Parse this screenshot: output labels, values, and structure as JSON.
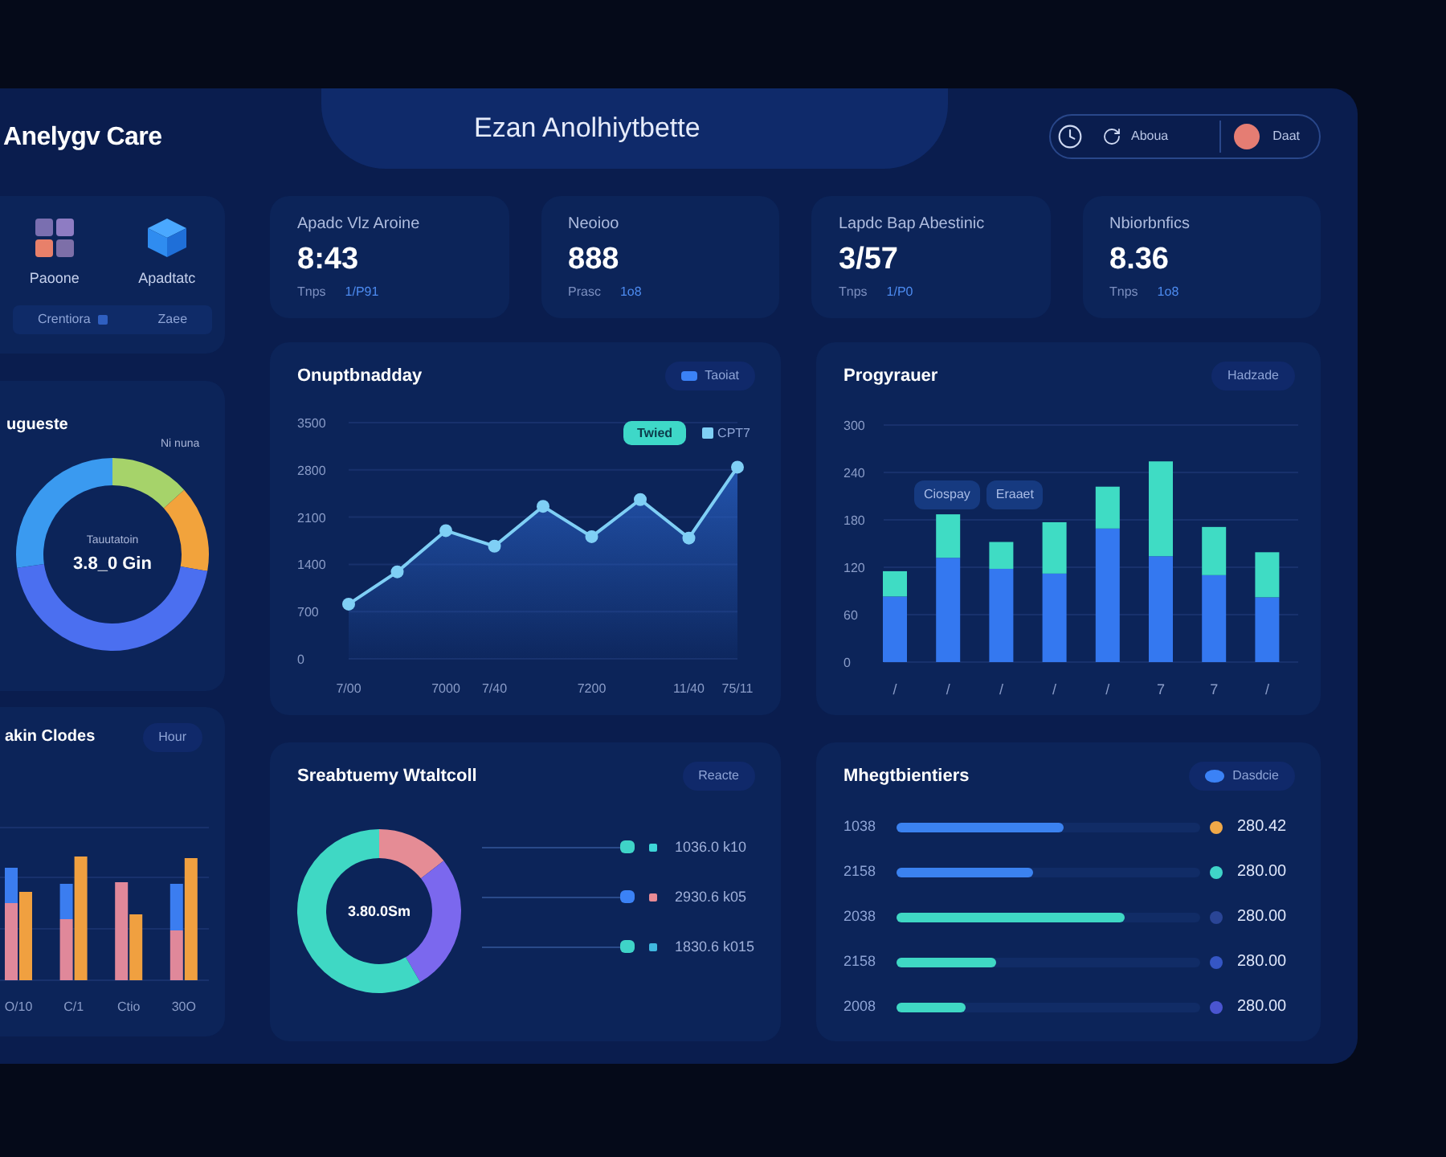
{
  "header": {
    "brand": "Anelygv Care",
    "title": "Ezan Anolhiytbette",
    "link": "Aboua",
    "user": "Daat"
  },
  "shortcuts": {
    "items": [
      {
        "label": "Paoone",
        "kind": "blocks"
      },
      {
        "label": "Apadtatc",
        "kind": "cube"
      }
    ],
    "buttons": [
      "Crentiora",
      "Zaee"
    ]
  },
  "kpis": [
    {
      "label": "Apadc Vlz Aroine",
      "value": "8:43",
      "caption": "Tnps",
      "change": "1/P91"
    },
    {
      "label": "Neoioo",
      "value": "888",
      "caption": "Prasc",
      "change": "1o8"
    },
    {
      "label": "Lapdc Bap Abestinic",
      "value": "3/57",
      "caption": "Tnps",
      "change": "1/P0"
    },
    {
      "label": "Nbiorbnfics",
      "value": "8.36",
      "caption": "Tnps",
      "change": "1o8"
    }
  ],
  "left_donut": {
    "title": "ugueste",
    "callout": "Ni nuna",
    "center_label": "Tauutatoin",
    "center_value": "3.8_0 Gin"
  },
  "line_panel": {
    "title": "Onuptbnadday",
    "toggle": "Taoiat",
    "badge": "Twied",
    "chart_data": {
      "type": "area",
      "grid": true,
      "categories": [
        "7/00",
        null,
        "7000",
        "7/40",
        null,
        "7200",
        null,
        "11/40",
        "75/11"
      ],
      "series": [
        {
          "name": "CPT7",
          "color": "#7fcff5",
          "values": [
            810,
            1290,
            1900,
            1670,
            2260,
            1810,
            2360,
            1790,
            2840
          ]
        }
      ],
      "ylim": [
        0,
        3500
      ],
      "yticks": [
        0,
        700,
        1400,
        2100,
        2800,
        3500
      ]
    }
  },
  "bar_panel": {
    "title": "Progyrauer",
    "toggle": "Hadzade",
    "tags": [
      "Ciospay",
      "Eraaet"
    ],
    "chart_data": {
      "type": "bar",
      "stacked": true,
      "grid": true,
      "categories": [
        "/",
        "/",
        "/",
        "/",
        "/",
        "7",
        "7",
        "/"
      ],
      "series": [
        {
          "color": "#3478f0",
          "values": [
            83,
            132,
            118,
            112,
            169,
            134,
            110,
            82
          ]
        },
        {
          "color": "#3fdcc4",
          "values": [
            32,
            55,
            34,
            65,
            53,
            120,
            61,
            57
          ]
        }
      ],
      "ylim": [
        0,
        300
      ],
      "yticks": [
        0,
        60,
        120,
        180,
        240,
        300
      ]
    }
  },
  "left_bars": {
    "title": "akin Clodes",
    "toggle": "Hour",
    "labels": [
      "O/10",
      "C/1",
      "Ctio",
      "30O"
    ]
  },
  "donut_panel": {
    "title": "Sreabtuemy Wtaltcoll",
    "toggle": "Reacte",
    "center": "3.80.0Sm",
    "legend": [
      {
        "label": "1036.0 k10",
        "color": "#3ed6d8",
        "marker": {
          "color": "#3fd4c8"
        }
      },
      {
        "label": "2930.6 k05",
        "color": "#e88a95",
        "marker": {
          "color": "#3b82f6"
        }
      },
      {
        "label": "1830.6 k015",
        "color": "#40b8e0",
        "marker": {
          "color": "#3fd4c8"
        }
      }
    ]
  },
  "list_panel": {
    "title": "Mhegtbientiers",
    "toggle": "Dasdcie",
    "rows": [
      {
        "label": "1038",
        "bar": {
          "level": 0.55,
          "color": "#3b82f0"
        },
        "color": "#f0a848",
        "value": "280.42"
      },
      {
        "label": "2158",
        "bar": {
          "level": 0.45,
          "color": "#3b82f0"
        },
        "color": "#3fd4c8",
        "value": "280.00"
      },
      {
        "label": "2038",
        "bar": {
          "level": 0.75,
          "color": "#3fd8c4"
        },
        "color": "#2a4596",
        "value": "280.00"
      },
      {
        "label": "2158",
        "bar": {
          "level": 0.33,
          "color": "#3fd8c4"
        },
        "color": "#3556c4",
        "value": "280.00"
      },
      {
        "label": "2008",
        "bar": {
          "level": 0.23,
          "color": "#3fd8c4"
        },
        "color": "#4a55d0",
        "value": "280.00"
      }
    ]
  }
}
